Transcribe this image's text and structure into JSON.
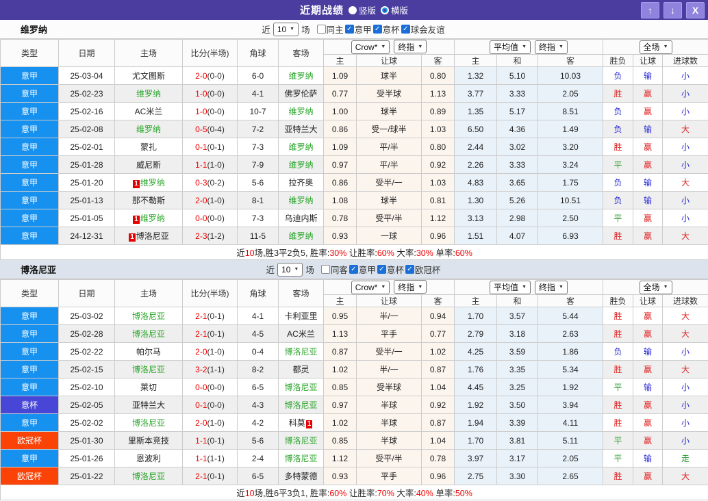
{
  "title": {
    "text": "近期战绩",
    "radio_vertical": "竖版",
    "radio_horizontal": "横版"
  },
  "icons": {
    "check": "✓",
    "dropdown_arrow": "▼",
    "up_arrow": "↑",
    "down_arrow": "↓",
    "close": "X"
  },
  "colors": {
    "titlebar_bg": "#4a3d9f",
    "title_button_bg": "#8e84de",
    "type_colors": {
      "意甲": "#1691f0",
      "意杯": "#4746d6",
      "欧冠杯": "#fb4307"
    },
    "team_highlight_green": "#2aa52a",
    "score_red": "#ee0000",
    "badge_red": "#e60000",
    "result_colors": {
      "胜": "#e02222",
      "平": "#2a9a2a",
      "负": "#2929d6",
      "赢": "#e02222",
      "输": "#2929d6",
      "大": "#e02222",
      "小": "#2929d6",
      "走": "#2a9a2a"
    },
    "crow_col_bg": "#fcf5ee",
    "avg_col_bg": "#e9f2f9",
    "alt_row_bg": "#efefef",
    "section2_filter_bg": "#dce3ec"
  },
  "table_header": {
    "static_cols": [
      "类型",
      "日期",
      "主场",
      "比分(半场)",
      "角球",
      "客场"
    ],
    "odds_sub": [
      "主",
      "让球",
      "客"
    ],
    "avg_sub": [
      "主",
      "和",
      "客"
    ],
    "result_sub": [
      "胜负",
      "让球",
      "进球数"
    ],
    "dropdown_crow": "Crow*",
    "dropdown_final_a": "终指",
    "dropdown_avg": "平均值",
    "dropdown_final_b": "终指",
    "dropdown_scope": "全场"
  },
  "sections": [
    {
      "team": "维罗纳",
      "filter": {
        "pre": "近",
        "count": "10",
        "post": "场",
        "checks": [
          {
            "label": "同主",
            "checked": false
          },
          {
            "label": "意甲",
            "checked": true
          },
          {
            "label": "意杯",
            "checked": true
          },
          {
            "label": "球会友谊",
            "checked": true
          }
        ]
      },
      "rows": [
        {
          "type": "意甲",
          "date": "25-03-04",
          "home": {
            "name": "尤文图斯"
          },
          "score": "2-0",
          "half": "(0-0)",
          "corner": "6-0",
          "away": {
            "name": "维罗纳",
            "green": true
          },
          "odds": [
            "1.09",
            "球半",
            "0.80"
          ],
          "avg": [
            "1.32",
            "5.10",
            "10.03"
          ],
          "results": [
            "负",
            "输",
            "小"
          ]
        },
        {
          "type": "意甲",
          "date": "25-02-23",
          "home": {
            "name": "维罗纳",
            "green": true
          },
          "score": "1-0",
          "half": "(0-0)",
          "corner": "4-1",
          "away": {
            "name": "佛罗伦萨"
          },
          "odds": [
            "0.77",
            "受半球",
            "1.13"
          ],
          "avg": [
            "3.77",
            "3.33",
            "2.05"
          ],
          "results": [
            "胜",
            "赢",
            "小"
          ]
        },
        {
          "type": "意甲",
          "date": "25-02-16",
          "home": {
            "name": "AC米兰"
          },
          "score": "1-0",
          "half": "(0-0)",
          "corner": "10-7",
          "away": {
            "name": "维罗纳",
            "green": true
          },
          "odds": [
            "1.00",
            "球半",
            "0.89"
          ],
          "avg": [
            "1.35",
            "5.17",
            "8.51"
          ],
          "results": [
            "负",
            "赢",
            "小"
          ]
        },
        {
          "type": "意甲",
          "date": "25-02-08",
          "home": {
            "name": "维罗纳",
            "green": true
          },
          "score": "0-5",
          "half": "(0-4)",
          "corner": "7-2",
          "away": {
            "name": "亚特兰大"
          },
          "odds": [
            "0.86",
            "受一/球半",
            "1.03"
          ],
          "avg": [
            "6.50",
            "4.36",
            "1.49"
          ],
          "results": [
            "负",
            "输",
            "大"
          ]
        },
        {
          "type": "意甲",
          "date": "25-02-01",
          "home": {
            "name": "蒙扎"
          },
          "score": "0-1",
          "half": "(0-1)",
          "corner": "7-3",
          "away": {
            "name": "维罗纳",
            "green": true
          },
          "odds": [
            "1.09",
            "平/半",
            "0.80"
          ],
          "avg": [
            "2.44",
            "3.02",
            "3.20"
          ],
          "results": [
            "胜",
            "赢",
            "小"
          ]
        },
        {
          "type": "意甲",
          "date": "25-01-28",
          "home": {
            "name": "威尼斯"
          },
          "score": "1-1",
          "half": "(1-0)",
          "corner": "7-9",
          "away": {
            "name": "维罗纳",
            "green": true
          },
          "odds": [
            "0.97",
            "平/半",
            "0.92"
          ],
          "avg": [
            "2.26",
            "3.33",
            "3.24"
          ],
          "results": [
            "平",
            "赢",
            "小"
          ]
        },
        {
          "type": "意甲",
          "date": "25-01-20",
          "home": {
            "name": "维罗纳",
            "green": true,
            "badge": "1"
          },
          "score": "0-3",
          "half": "(0-2)",
          "corner": "5-6",
          "away": {
            "name": "拉齐奥"
          },
          "odds": [
            "0.86",
            "受半/一",
            "1.03"
          ],
          "avg": [
            "4.83",
            "3.65",
            "1.75"
          ],
          "results": [
            "负",
            "输",
            "大"
          ]
        },
        {
          "type": "意甲",
          "date": "25-01-13",
          "home": {
            "name": "那不勒斯"
          },
          "score": "2-0",
          "half": "(1-0)",
          "corner": "8-1",
          "away": {
            "name": "维罗纳",
            "green": true
          },
          "odds": [
            "1.08",
            "球半",
            "0.81"
          ],
          "avg": [
            "1.30",
            "5.26",
            "10.51"
          ],
          "results": [
            "负",
            "输",
            "小"
          ]
        },
        {
          "type": "意甲",
          "date": "25-01-05",
          "home": {
            "name": "维罗纳",
            "green": true,
            "badge": "1"
          },
          "score": "0-0",
          "half": "(0-0)",
          "corner": "7-3",
          "away": {
            "name": "乌迪内斯"
          },
          "odds": [
            "0.78",
            "受平/半",
            "1.12"
          ],
          "avg": [
            "3.13",
            "2.98",
            "2.50"
          ],
          "results": [
            "平",
            "赢",
            "小"
          ]
        },
        {
          "type": "意甲",
          "date": "24-12-31",
          "home": {
            "name": "博洛尼亚",
            "badge": "1"
          },
          "score": "2-3",
          "half": "(1-2)",
          "corner": "11-5",
          "away": {
            "name": "维罗纳",
            "green": true
          },
          "odds": [
            "0.93",
            "一球",
            "0.96"
          ],
          "avg": [
            "1.51",
            "4.07",
            "6.93"
          ],
          "results": [
            "胜",
            "赢",
            "大"
          ]
        }
      ],
      "summary": [
        {
          "t": "近"
        },
        {
          "t": "10",
          "red": true
        },
        {
          "t": "场,胜3平2负5, 胜率:"
        },
        {
          "t": "30%",
          "red": true
        },
        {
          "t": " 让胜率:"
        },
        {
          "t": "60%",
          "red": true
        },
        {
          "t": " 大率:"
        },
        {
          "t": "30%",
          "red": true
        },
        {
          "t": " 单率:"
        },
        {
          "t": "60%",
          "red": true
        }
      ]
    },
    {
      "team": "博洛尼亚",
      "filter": {
        "pre": "近",
        "count": "10",
        "post": "场",
        "checks": [
          {
            "label": "同客",
            "checked": false
          },
          {
            "label": "意甲",
            "checked": true
          },
          {
            "label": "意杯",
            "checked": true
          },
          {
            "label": "欧冠杯",
            "checked": true
          }
        ]
      },
      "rows": [
        {
          "type": "意甲",
          "date": "25-03-02",
          "home": {
            "name": "博洛尼亚",
            "green": true
          },
          "score": "2-1",
          "half": "(0-1)",
          "corner": "4-1",
          "away": {
            "name": "卡利亚里"
          },
          "odds": [
            "0.95",
            "半/一",
            "0.94"
          ],
          "avg": [
            "1.70",
            "3.57",
            "5.44"
          ],
          "results": [
            "胜",
            "赢",
            "大"
          ]
        },
        {
          "type": "意甲",
          "date": "25-02-28",
          "home": {
            "name": "博洛尼亚",
            "green": true
          },
          "score": "2-1",
          "half": "(0-1)",
          "corner": "4-5",
          "away": {
            "name": "AC米兰"
          },
          "odds": [
            "1.13",
            "平手",
            "0.77"
          ],
          "avg": [
            "2.79",
            "3.18",
            "2.63"
          ],
          "results": [
            "胜",
            "赢",
            "大"
          ]
        },
        {
          "type": "意甲",
          "date": "25-02-22",
          "home": {
            "name": "帕尔马"
          },
          "score": "2-0",
          "half": "(1-0)",
          "corner": "0-4",
          "away": {
            "name": "博洛尼亚",
            "green": true
          },
          "odds": [
            "0.87",
            "受半/一",
            "1.02"
          ],
          "avg": [
            "4.25",
            "3.59",
            "1.86"
          ],
          "results": [
            "负",
            "输",
            "小"
          ]
        },
        {
          "type": "意甲",
          "date": "25-02-15",
          "home": {
            "name": "博洛尼亚",
            "green": true
          },
          "score": "3-2",
          "half": "(1-1)",
          "corner": "8-2",
          "away": {
            "name": "都灵"
          },
          "odds": [
            "1.02",
            "半/一",
            "0.87"
          ],
          "avg": [
            "1.76",
            "3.35",
            "5.34"
          ],
          "results": [
            "胜",
            "赢",
            "大"
          ]
        },
        {
          "type": "意甲",
          "date": "25-02-10",
          "home": {
            "name": "莱切"
          },
          "score": "0-0",
          "half": "(0-0)",
          "corner": "6-5",
          "away": {
            "name": "博洛尼亚",
            "green": true
          },
          "odds": [
            "0.85",
            "受半球",
            "1.04"
          ],
          "avg": [
            "4.45",
            "3.25",
            "1.92"
          ],
          "results": [
            "平",
            "输",
            "小"
          ]
        },
        {
          "type": "意杯",
          "date": "25-02-05",
          "home": {
            "name": "亚特兰大"
          },
          "score": "0-1",
          "half": "(0-0)",
          "corner": "4-3",
          "away": {
            "name": "博洛尼亚",
            "green": true
          },
          "odds": [
            "0.97",
            "半球",
            "0.92"
          ],
          "avg": [
            "1.92",
            "3.50",
            "3.94"
          ],
          "results": [
            "胜",
            "赢",
            "小"
          ]
        },
        {
          "type": "意甲",
          "date": "25-02-02",
          "home": {
            "name": "博洛尼亚",
            "green": true
          },
          "score": "2-0",
          "half": "(1-0)",
          "corner": "4-2",
          "away": {
            "name": "科莫",
            "badge_after": "1"
          },
          "odds": [
            "1.02",
            "半球",
            "0.87"
          ],
          "avg": [
            "1.94",
            "3.39",
            "4.11"
          ],
          "results": [
            "胜",
            "赢",
            "小"
          ]
        },
        {
          "type": "欧冠杯",
          "date": "25-01-30",
          "home": {
            "name": "里斯本竞技"
          },
          "score": "1-1",
          "half": "(0-1)",
          "corner": "5-6",
          "away": {
            "name": "博洛尼亚",
            "green": true
          },
          "odds": [
            "0.85",
            "半球",
            "1.04"
          ],
          "avg": [
            "1.70",
            "3.81",
            "5.11"
          ],
          "results": [
            "平",
            "赢",
            "小"
          ]
        },
        {
          "type": "意甲",
          "date": "25-01-26",
          "home": {
            "name": "恩波利"
          },
          "score": "1-1",
          "half": "(1-1)",
          "corner": "2-4",
          "away": {
            "name": "博洛尼亚",
            "green": true
          },
          "odds": [
            "1.12",
            "受平/半",
            "0.78"
          ],
          "avg": [
            "3.97",
            "3.17",
            "2.05"
          ],
          "results": [
            "平",
            "输",
            "走"
          ]
        },
        {
          "type": "欧冠杯",
          "date": "25-01-22",
          "home": {
            "name": "博洛尼亚",
            "green": true
          },
          "score": "2-1",
          "half": "(0-1)",
          "corner": "6-5",
          "away": {
            "name": "多特蒙德"
          },
          "odds": [
            "0.93",
            "平手",
            "0.96"
          ],
          "avg": [
            "2.75",
            "3.30",
            "2.65"
          ],
          "results": [
            "胜",
            "赢",
            "大"
          ]
        }
      ],
      "summary": [
        {
          "t": "近"
        },
        {
          "t": "10",
          "red": true
        },
        {
          "t": "场,胜6平3负1, 胜率:"
        },
        {
          "t": "60%",
          "red": true
        },
        {
          "t": " 让胜率:"
        },
        {
          "t": "70%",
          "red": true
        },
        {
          "t": " 大率:"
        },
        {
          "t": "40%",
          "red": true
        },
        {
          "t": " 单率:"
        },
        {
          "t": "50%",
          "red": true
        }
      ]
    }
  ]
}
